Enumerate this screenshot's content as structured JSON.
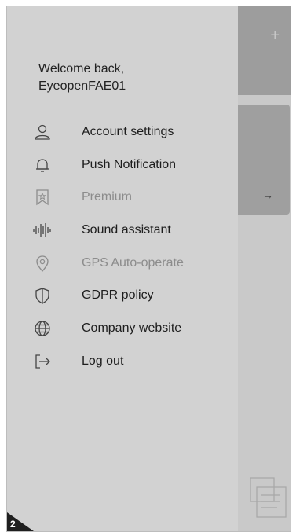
{
  "background": {
    "plus_symbol": "+",
    "arrow_symbol": "→"
  },
  "drawer": {
    "welcome_line1": "Welcome back,",
    "welcome_line2": "EyeopenFAE01",
    "items": [
      {
        "label": "Account settings",
        "icon": "person-icon",
        "enabled": true
      },
      {
        "label": "Push Notification",
        "icon": "bell-icon",
        "enabled": true
      },
      {
        "label": "Premium",
        "icon": "bookmark-star-icon",
        "enabled": false
      },
      {
        "label": "Sound assistant",
        "icon": "sound-wave-icon",
        "enabled": true
      },
      {
        "label": "GPS Auto-operate",
        "icon": "location-pin-icon",
        "enabled": false
      },
      {
        "label": "GDPR policy",
        "icon": "shield-icon",
        "enabled": true
      },
      {
        "label": "Company website",
        "icon": "globe-icon",
        "enabled": true
      },
      {
        "label": "Log out",
        "icon": "logout-icon",
        "enabled": true
      }
    ]
  },
  "page_number": "2"
}
